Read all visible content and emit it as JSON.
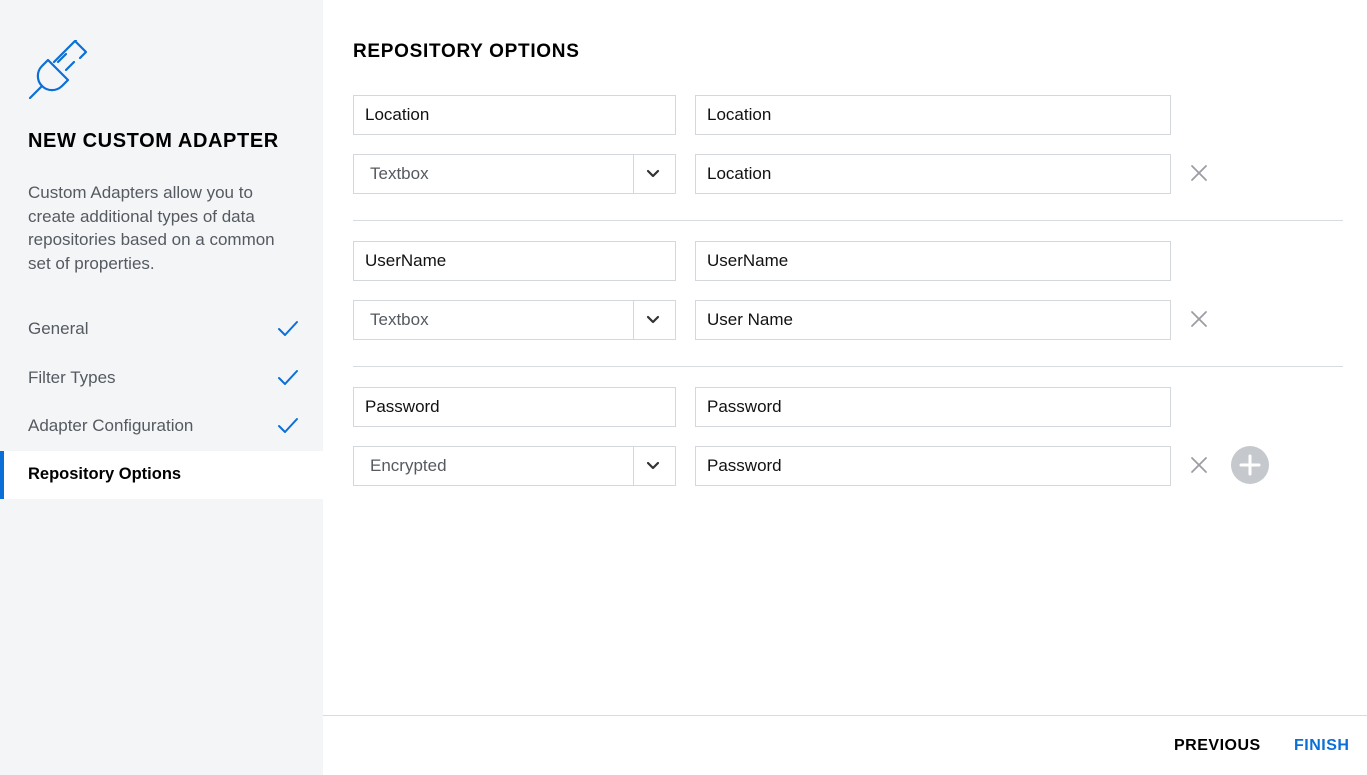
{
  "sidebar": {
    "title": "NEW CUSTOM ADAPTER",
    "description": "Custom Adapters allow you to create additional types of data repositories based on a common set of properties.",
    "steps": [
      {
        "label": "General",
        "completed": true
      },
      {
        "label": "Filter Types",
        "completed": true
      },
      {
        "label": "Adapter Configuration",
        "completed": true
      },
      {
        "label": "Repository Options",
        "active": true
      }
    ]
  },
  "main": {
    "title": "REPOSITORY OPTIONS",
    "options": [
      {
        "name": "Location",
        "label": "Location",
        "type": "Textbox",
        "display_name": "Location"
      },
      {
        "name": "UserName",
        "label": "UserName",
        "type": "Textbox",
        "display_name": "User Name"
      },
      {
        "name": "Password",
        "label": "Password",
        "type": "Encrypted",
        "display_name": "Password"
      }
    ]
  },
  "footer": {
    "previous_label": "PREVIOUS",
    "finish_label": "FINISH"
  },
  "colors": {
    "accent": "#0a6fd6",
    "sidebar_bg": "#f4f5f7",
    "border": "#d4d7dc"
  }
}
